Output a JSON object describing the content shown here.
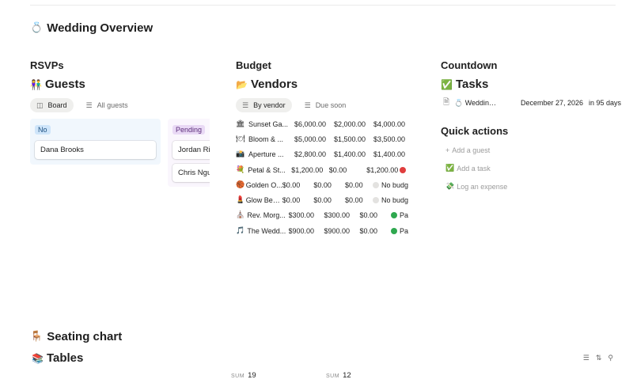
{
  "page": {
    "title": "Wedding Overview",
    "title_icon": "💍"
  },
  "rsvps": {
    "label": "RSVPs",
    "db_title": "Guests",
    "db_icon": "👫",
    "views": [
      {
        "label": "Board",
        "icon": "board-icon",
        "active": true
      },
      {
        "label": "All guests",
        "icon": "list-icon",
        "active": false
      }
    ],
    "columns": [
      {
        "status": "No",
        "color": "#cfe5fa",
        "cards": [
          "Dana Brooks"
        ]
      },
      {
        "status": "Pending",
        "color": "#e9d9f5",
        "cards": [
          "Jordan Riv",
          "Chris Ngu"
        ]
      }
    ]
  },
  "budget": {
    "label": "Budget",
    "db_title": "Vendors",
    "db_icon": "📂",
    "views": [
      {
        "label": "By vendor",
        "icon": "list-icon",
        "active": true
      },
      {
        "label": "Due soon",
        "icon": "list-icon",
        "active": false
      }
    ],
    "rows": [
      {
        "icon": "🏛",
        "name": "Sunset Ga...",
        "c1": "$6,000.00",
        "c2": "$2,000.00",
        "c3": "$4,000.00",
        "status": "",
        "dot": ""
      },
      {
        "icon": "🍽",
        "name": "Bloom & ...",
        "c1": "$5,000.00",
        "c2": "$1,500.00",
        "c3": "$3,500.00",
        "status": "",
        "dot": ""
      },
      {
        "icon": "📸",
        "name": "Aperture ...",
        "c1": "$2,800.00",
        "c2": "$1,400.00",
        "c3": "$1,400.00",
        "status": "",
        "dot": ""
      },
      {
        "icon": "💐",
        "name": "Petal & St...",
        "c1": "$1,200.00",
        "c2": "$0.00",
        "c3": "$1,200.00",
        "status": "",
        "dot": "#e03e3e"
      },
      {
        "icon": "🏀",
        "name": "Golden O...",
        "c1": "$0.00",
        "c2": "$0.00",
        "c3": "$0.00",
        "status": "No budg",
        "dot": "#e3e2e0"
      },
      {
        "icon": "💄",
        "name": "Glow Bea...",
        "c1": "$0.00",
        "c2": "$0.00",
        "c3": "$0.00",
        "status": "No budg",
        "dot": "#e3e2e0"
      },
      {
        "icon": "⛪",
        "name": "Rev. Morg...",
        "c1": "$300.00",
        "c2": "$300.00",
        "c3": "$0.00",
        "status": "Pa",
        "dot": "#2fa84f"
      },
      {
        "icon": "🎵",
        "name": "The Wedd...",
        "c1": "$900.00",
        "c2": "$900.00",
        "c3": "$0.00",
        "status": "Pa",
        "dot": "#2fa84f"
      }
    ]
  },
  "countdown": {
    "label": "Countdown",
    "db_title": "Tasks",
    "db_icon": "✅",
    "task": {
      "icon": "page-icon",
      "name": "💍 Wedding ...",
      "date": "December 27, 2026",
      "days": "in 95 days"
    }
  },
  "quick_actions": {
    "label": "Quick actions",
    "items": [
      {
        "icon": "+",
        "label": "Add a guest"
      },
      {
        "icon": "✅",
        "label": "Add a task"
      },
      {
        "icon": "💸",
        "label": "Log an expense"
      }
    ]
  },
  "seating": {
    "title": "Seating chart",
    "title_icon": "🪑",
    "db_title": "Tables",
    "db_icon": "📚",
    "sums": [
      {
        "label": "SUM",
        "value": "19"
      },
      {
        "label": "SUM",
        "value": "12"
      }
    ]
  },
  "colors": {
    "accent_blue": "#cfe5fa",
    "accent_purple": "#e9d9f5",
    "red": "#e03e3e",
    "green": "#2fa84f"
  }
}
